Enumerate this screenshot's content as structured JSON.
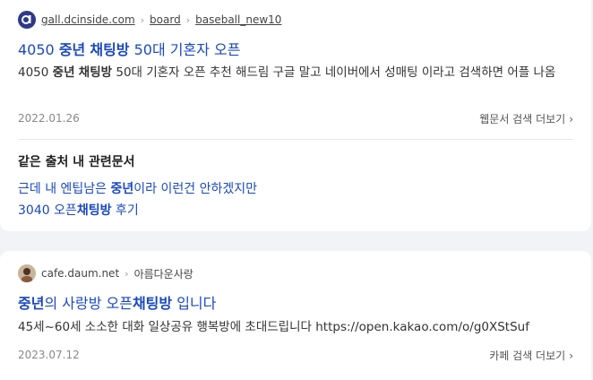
{
  "result1": {
    "source": {
      "domain": "gall.dcinside.com",
      "path": [
        "board",
        "baseball_new10"
      ]
    },
    "title": {
      "pre": "4050 ",
      "bold1": "중년",
      "mid": " ",
      "bold2": "채팅방",
      "post": " 50대 기혼자 오픈"
    },
    "snippet": {
      "pre": "4050 ",
      "bold1": "중년",
      "mid": " ",
      "bold2": "채팅방",
      "post": " 50대 기혼자 오픈 추천 해드림 구글 말고 네이버에서 성매팅 이라고 검색하면 어플 나옴"
    },
    "date": "2022.01.26",
    "more_label": "웹문서 검색 더보기",
    "related": {
      "heading": "같은 출처 내 관련문서",
      "links": [
        {
          "pre": "근데 내 엔팁남은 ",
          "bold": "중년",
          "post": "이라 이런건 안하겠지만"
        },
        {
          "pre": "3040 오픈",
          "bold": "채팅방",
          "post": " 후기"
        }
      ]
    }
  },
  "result2": {
    "source": {
      "domain": "cafe.daum.net",
      "path": [
        "아름다운사랑"
      ]
    },
    "title": {
      "bold1": "중년",
      "mid": "의 사랑방 오픈",
      "bold2": "채팅방",
      "post": " 입니다"
    },
    "snippet": "45세~60세 소소한 대화 일상공유 행복방에 초대드립니다 https://open.kakao.com/o/g0XStSuf",
    "date": "2023.07.12",
    "more_label": "카페 검색 더보기"
  },
  "colors": {
    "link": "#1a49c0",
    "background": "#f1f3f6"
  },
  "icons": [
    "dcinside-favicon",
    "daum-cafe-favicon",
    "chevron-right-icon"
  ]
}
